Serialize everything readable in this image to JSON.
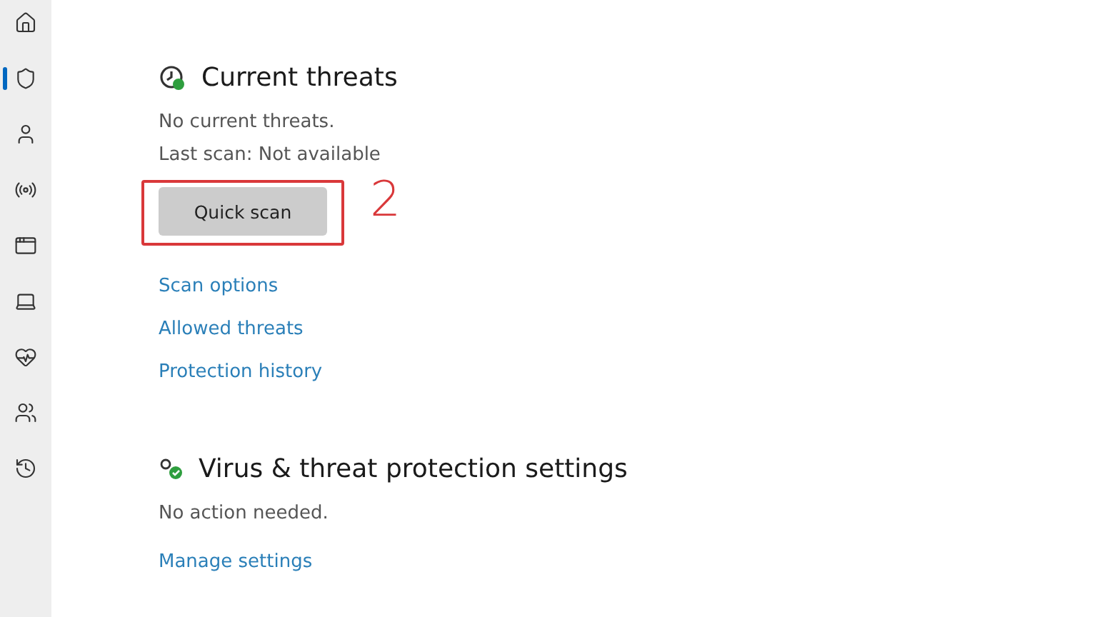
{
  "sidebar": {
    "items": [
      {
        "kind": "home",
        "selected": false
      },
      {
        "kind": "shield",
        "selected": true
      },
      {
        "kind": "account",
        "selected": false
      },
      {
        "kind": "network",
        "selected": false
      },
      {
        "kind": "app",
        "selected": false
      },
      {
        "kind": "device",
        "selected": false
      },
      {
        "kind": "health",
        "selected": false
      },
      {
        "kind": "family",
        "selected": false
      },
      {
        "kind": "history",
        "selected": false
      }
    ]
  },
  "sections": [
    {
      "kind": "threats",
      "title": "Current threats",
      "lines": [
        "No current threats.",
        "Last scan: Not available"
      ],
      "button": "Quick scan",
      "annotation": "2",
      "links": [
        "Scan options",
        "Allowed threats",
        "Protection history"
      ]
    },
    {
      "kind": "settings",
      "title": "Virus & threat protection settings",
      "lines": [
        "No action needed."
      ],
      "links": [
        "Manage settings"
      ]
    }
  ]
}
